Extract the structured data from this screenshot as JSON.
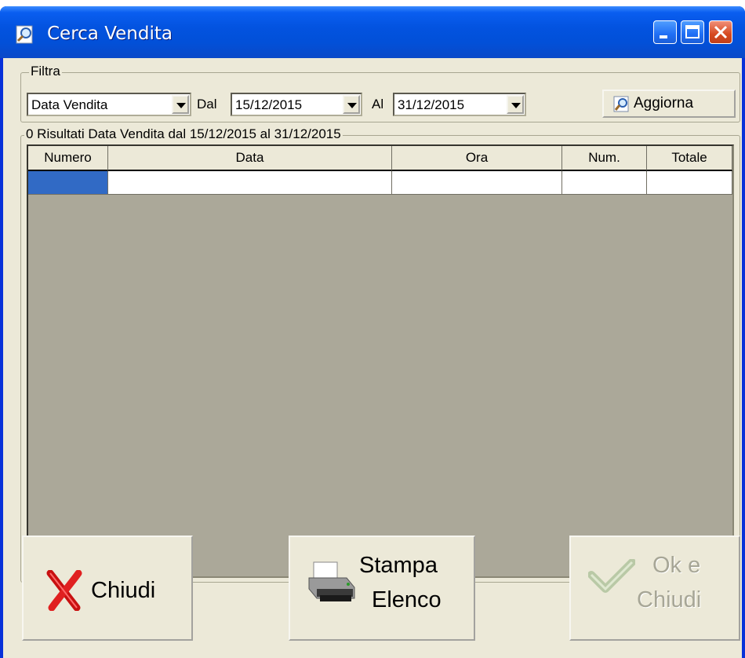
{
  "window": {
    "title": "Cerca Vendita"
  },
  "filter": {
    "legend": "Filtra",
    "field_value": "Data Vendita",
    "from_label": "Dal",
    "from_value": "15/12/2015",
    "to_label": "Al",
    "to_value": "31/12/2015",
    "refresh_label": "Aggiorna"
  },
  "results": {
    "legend": "0 Risultati Data Vendita dal 15/12/2015 al 31/12/2015",
    "columns": [
      "Numero",
      "Data",
      "Ora",
      "Num.",
      "Totale"
    ],
    "row_selected_color": "#316ac5"
  },
  "buttons": {
    "close_label": "Chiudi",
    "print_line1": "Stampa",
    "print_line2": "Elenco",
    "ok_line1": "Ok e",
    "ok_line2": "Chiudi"
  },
  "icons": [
    "search-icon",
    "minimize-icon",
    "maximize-icon",
    "close-icon",
    "red-x-icon",
    "printer-icon",
    "green-check-icon"
  ],
  "colors": {
    "titlebar": "#0353e0",
    "face": "#ece9d8",
    "grid_bg": "#aba899",
    "selection": "#316ac5"
  }
}
